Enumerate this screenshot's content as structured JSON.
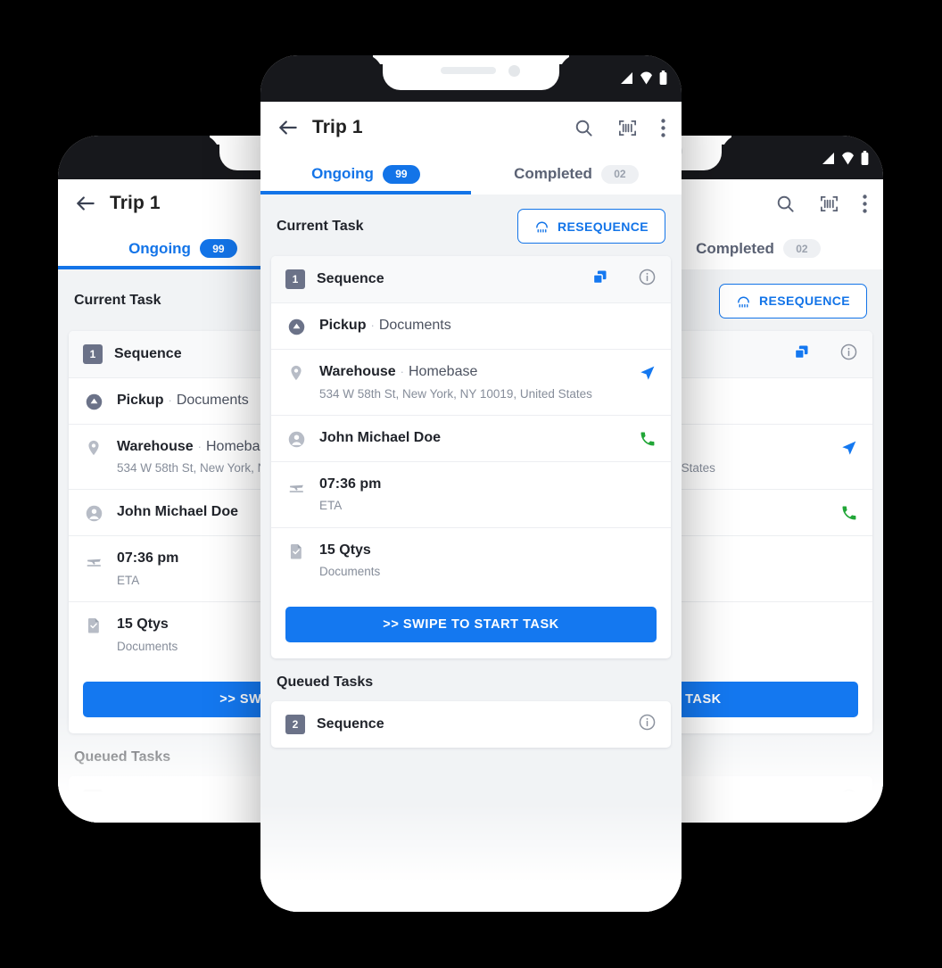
{
  "app": {
    "title": "Trip 1",
    "back_icon": "arrow-left-icon",
    "actions": [
      {
        "name": "search-icon",
        "label": "Search"
      },
      {
        "name": "barcode-scan-icon",
        "label": "Scan"
      },
      {
        "name": "overflow-menu-icon",
        "label": "More options"
      }
    ]
  },
  "statusbar": {
    "signal_icon": "signal-bars-icon",
    "wifi_icon": "wifi-icon",
    "battery_icon": "battery-icon"
  },
  "tabs": [
    {
      "label": "Ongoing",
      "count": "99",
      "active": true
    },
    {
      "label": "Completed",
      "count": "02",
      "active": false
    }
  ],
  "current_task": {
    "section_title": "Current Task",
    "resequence_label": "RESEQUENCE",
    "resequence_icon": "resequence-icon",
    "sequence_number": "1",
    "sequence_label": "Sequence",
    "copy_icon": "copy-icon",
    "info_icon": "info-icon",
    "rows": [
      {
        "icon": "pickup-icon",
        "title": "Pickup",
        "separator": "·",
        "detail": "Documents",
        "sub": "",
        "action_icon": ""
      },
      {
        "icon": "location-pin-icon",
        "title": "Warehouse",
        "separator": "·",
        "detail": "Homebase",
        "sub": "534 W 58th St, New York, NY 10019, United States",
        "action_icon": "navigate-icon"
      },
      {
        "icon": "person-icon",
        "title": "John Michael Doe",
        "separator": "",
        "detail": "",
        "sub": "",
        "action_icon": "phone-call-icon"
      },
      {
        "icon": "eta-plane-icon",
        "title": "07:36 pm",
        "separator": "",
        "detail": "",
        "sub": "ETA",
        "action_icon": ""
      },
      {
        "icon": "document-check-icon",
        "title": "15 Qtys",
        "separator": "",
        "detail": "",
        "sub": "Documents",
        "action_icon": ""
      }
    ],
    "swipe_label": ">> SWIPE TO START TASK"
  },
  "queued_tasks": {
    "section_title": "Queued Tasks",
    "sequence_number": "2",
    "sequence_label": "Sequence",
    "info_icon": "info-icon"
  },
  "colors": {
    "accent_blue": "#1374e8",
    "button_blue": "#1478f0",
    "chip_gray": "#6b7288",
    "green": "#21a637",
    "bg_gray": "#f1f3f5",
    "status_dark": "#17181c"
  }
}
